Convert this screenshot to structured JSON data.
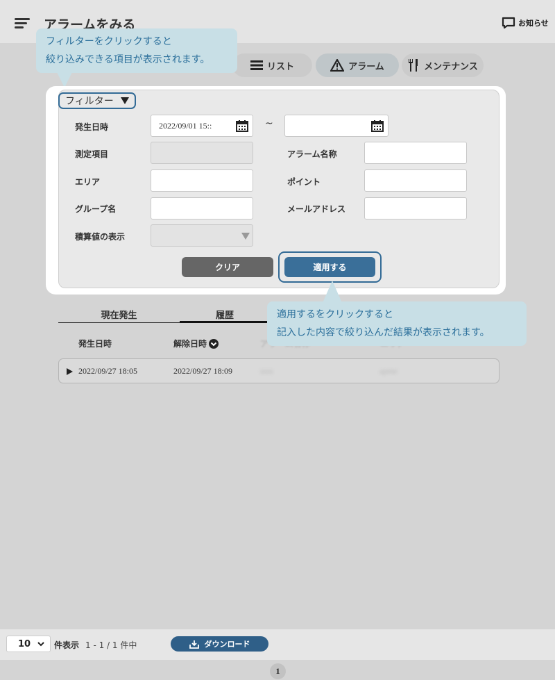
{
  "header": {
    "title": "アラームをみる",
    "notice_label": "お知らせ"
  },
  "nav_tabs": [
    {
      "label": "リスト",
      "icon": "list-icon"
    },
    {
      "label": "アラーム",
      "icon": "warning-icon"
    },
    {
      "label": "メンテナンス",
      "icon": "tools-icon"
    }
  ],
  "callouts": {
    "filter": {
      "line1": "フィルターをクリックすると",
      "line2": "絞り込みできる項目が表示されます。"
    },
    "apply": {
      "line1": "適用するをクリックすると",
      "line2": "記入した内容で絞り込んだ結果が表示されます。"
    }
  },
  "filter": {
    "toggle_label": "フィルター",
    "fields": {
      "occurrence_date": {
        "label": "発生日時",
        "from_value": "2022/09/01 15::",
        "to_value": "",
        "separator": "~"
      },
      "measure_item": {
        "label": "測定項目",
        "value": ""
      },
      "alarm_name": {
        "label": "アラーム名称",
        "value": ""
      },
      "area": {
        "label": "エリア",
        "value": ""
      },
      "point": {
        "label": "ポイント",
        "value": ""
      },
      "group_name": {
        "label": "グループ名",
        "value": ""
      },
      "mail_address": {
        "label": "メールアドレス",
        "value": ""
      },
      "cumulative_display": {
        "label": "積算値の表示",
        "value": ""
      }
    },
    "clear_label": "クリア",
    "apply_label": "適用する"
  },
  "sub_tabs": [
    {
      "label": "現在発生"
    },
    {
      "label": "履歴"
    }
  ],
  "table": {
    "headers": [
      "発生日時",
      "解除日時",
      "アラーム名称",
      "エリア"
    ],
    "rows": [
      {
        "occurred": "2022/09/27 18:05",
        "released": "2022/09/27 18:09",
        "col3": "ssss",
        "col4": "apme"
      }
    ]
  },
  "footer": {
    "per_page": "10",
    "per_page_label": "件表示",
    "range_text": "1 - 1 / 1 件中",
    "download_label": "ダウンロード",
    "current_page": "1"
  },
  "colors": {
    "accent": "#3a6f99",
    "callout_bg": "#c8dfe6",
    "callout_text": "#2b6f9b"
  }
}
